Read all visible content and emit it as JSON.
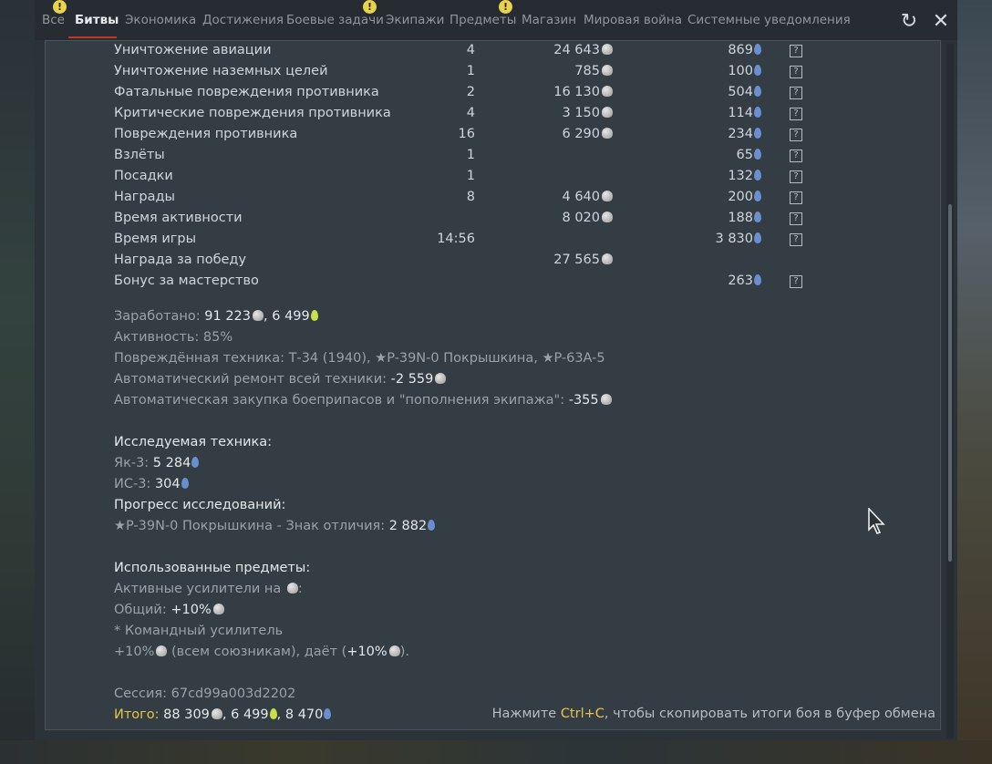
{
  "tabs": [
    {
      "label": "Все",
      "alert": true
    },
    {
      "label": "Битвы",
      "active": true
    },
    {
      "label": "Экономика"
    },
    {
      "label": "Достижения"
    },
    {
      "label": "Боевые задачи",
      "alert": true
    },
    {
      "label": "Экипажи"
    },
    {
      "label": "Предметы",
      "alert": true
    },
    {
      "label": "Магазин"
    },
    {
      "label": "Мировая война"
    },
    {
      "label": "Системные уведомления"
    }
  ],
  "header": {
    "refresh_icon": "↻",
    "close_icon": "✕",
    "alert_mark": "!"
  },
  "rewards": [
    {
      "name": "Уничтожение авиации",
      "count": "4",
      "silver": "24 643",
      "rp": "869"
    },
    {
      "name": "Уничтожение наземных целей",
      "count": "1",
      "silver": "785",
      "rp": "100"
    },
    {
      "name": "Фатальные повреждения противника",
      "count": "2",
      "silver": "16 130",
      "rp": "504"
    },
    {
      "name": "Критические повреждения противника",
      "count": "4",
      "silver": "3 150",
      "rp": "114"
    },
    {
      "name": "Повреждения противника",
      "count": "16",
      "silver": "6 290",
      "rp": "234"
    },
    {
      "name": "Взлёты",
      "count": "1",
      "silver": "",
      "rp": "65"
    },
    {
      "name": "Посадки",
      "count": "1",
      "silver": "",
      "rp": "132"
    },
    {
      "name": "Награды",
      "count": "8",
      "silver": "4 640",
      "rp": "200"
    },
    {
      "name": "Время активности",
      "count": "",
      "silver": "8 020",
      "rp": "188"
    },
    {
      "name": "Время игры",
      "count": "14:56",
      "silver": "",
      "rp": "3 830"
    },
    {
      "name": "Награда за победу",
      "count": "",
      "silver": "27 565",
      "rp": ""
    },
    {
      "name": "Бонус за мастерство",
      "count": "",
      "silver": "",
      "rp": "263"
    }
  ],
  "help_mark": "?",
  "summary": {
    "earned_label": "Заработано: ",
    "earned_silver": "91 223",
    "earned_sep": ", ",
    "earned_rp": "6 499",
    "activity": "Активность: 85%",
    "damaged": "Повреждённая техника: Т-34 (1940), ★P-39N-0 Покрышкина, ★P-63A-5",
    "repair_label": "Автоматический ремонт всей техники: ",
    "repair_value": "-2 559",
    "ammo_label": "Автоматическая закупка боеприпасов и \"пополнения экипажа\": ",
    "ammo_value": "-355"
  },
  "research": {
    "title": "Исследуемая техника:",
    "items": [
      {
        "label": "Як-3: ",
        "value": "5 284"
      },
      {
        "label": "ИС-3: ",
        "value": "304"
      }
    ],
    "progress_title": "Прогресс исследований:",
    "progress_label": "★P-39N-0 Покрышкина - Знак отличия: ",
    "progress_value": "2 882"
  },
  "items_used": {
    "title": "Использованные предметы:",
    "active_label": "Активные усилители на ",
    "active_suffix": ":",
    "general_label": "Общий: ",
    "general_value": "+10%",
    "command": "* Командный усилитель",
    "allies_value": "+10%",
    "allies_text": " (всем союзникам), даёт (",
    "allies_bonus": "+10%",
    "allies_end": ")."
  },
  "session": "Сессия: 67cd99a003d2202",
  "total": {
    "label": "Итого:",
    "silver": " 88 309",
    "sep1": ", ",
    "rp_gold": "6 499",
    "sep2": ", ",
    "rp": "8 470"
  },
  "hint": {
    "prefix": "Нажмите ",
    "keys": "Ctrl+C",
    "suffix": ", чтобы скопировать итоги боя в буфер обмена"
  }
}
